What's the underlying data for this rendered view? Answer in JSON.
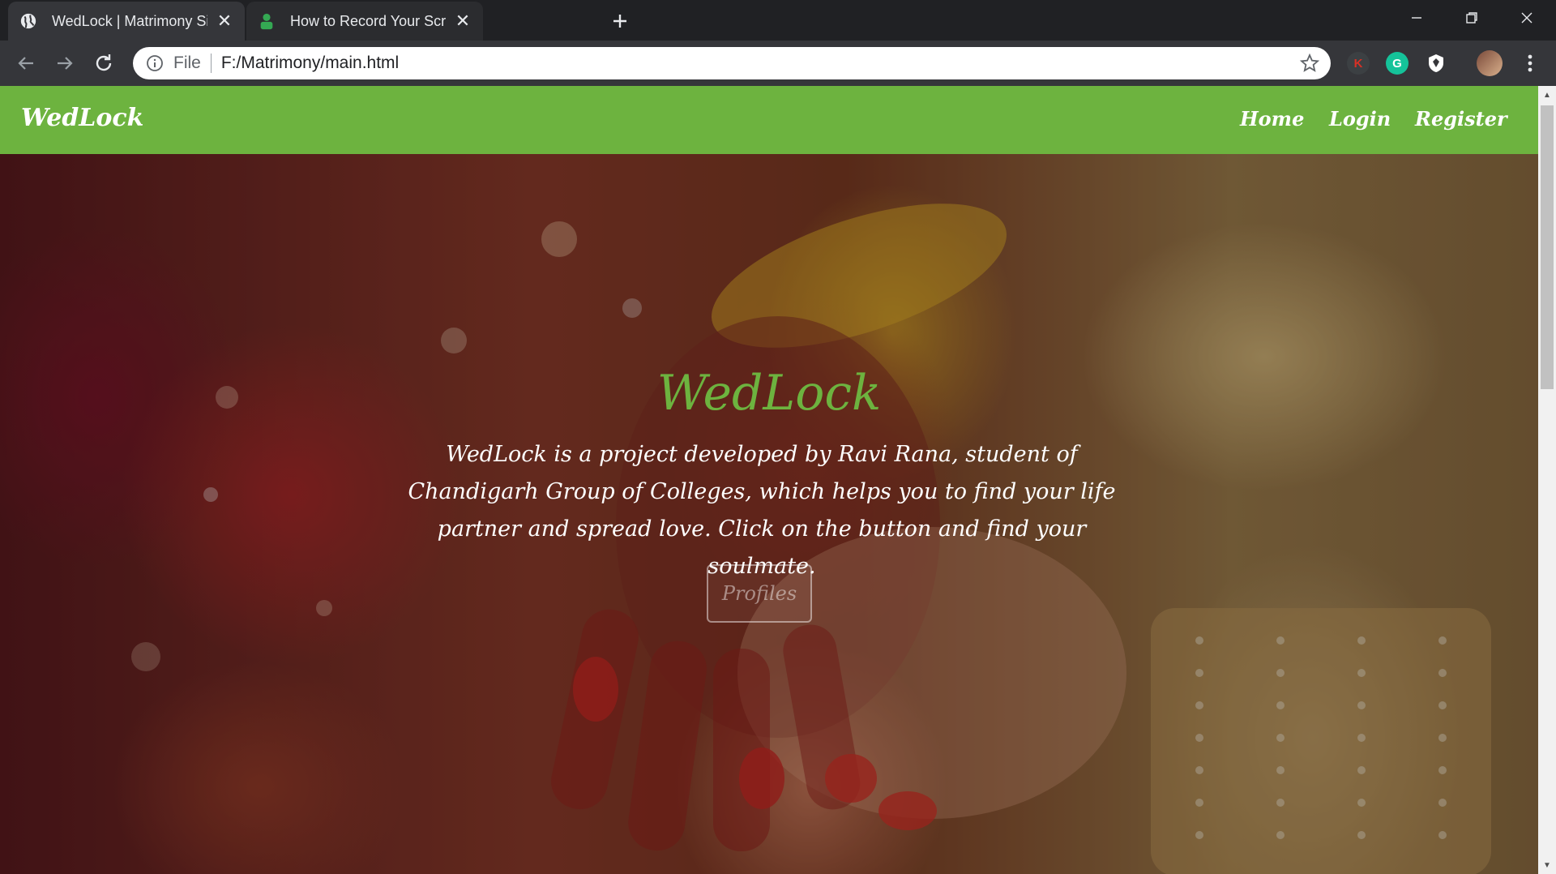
{
  "browser": {
    "tabs": [
      {
        "title": "WedLock | Matrimony Site",
        "active": true,
        "favicon": "globe-icon"
      },
      {
        "title": "How to Record Your Screen on W",
        "active": false,
        "favicon": "person-icon"
      }
    ],
    "address": {
      "scheme_label": "File",
      "url": "F:/Matrimony/main.html"
    },
    "extensions": [
      {
        "name": "k-extension-icon",
        "letter": "K",
        "color": "#d93025"
      },
      {
        "name": "grammarly-icon",
        "letter": "G",
        "color": "#15c39a"
      },
      {
        "name": "shield-extension-icon",
        "letter": "",
        "color": "#ffffff"
      }
    ]
  },
  "page": {
    "navbar": {
      "brand": "WedLock",
      "links": [
        "Home",
        "Login",
        "Register"
      ],
      "color": "#6db33f"
    },
    "hero": {
      "title": "WedLock",
      "description": "WedLock is a project developed by Ravi Rana, student of Chandigarh Group of Colleges, which helps you to find your life partner and spread love. Click on the button and find your soulmate.",
      "button_label": "Profiles"
    }
  }
}
